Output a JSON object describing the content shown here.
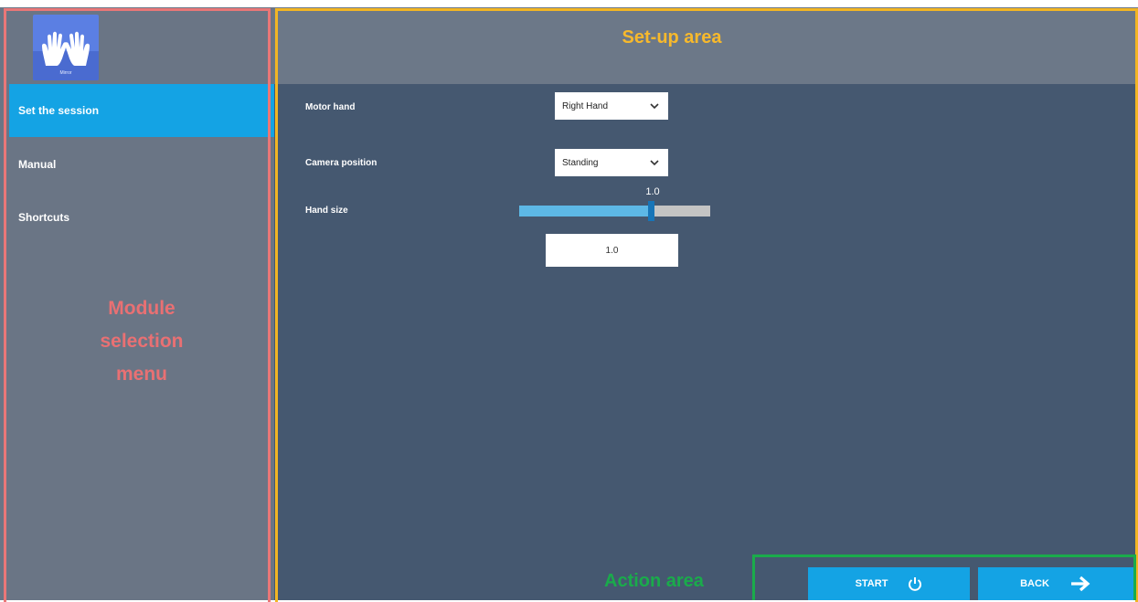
{
  "sidebar": {
    "logo_text": "Mirror",
    "items": [
      {
        "label": "Set the session",
        "active": true
      },
      {
        "label": "Manual",
        "active": false
      },
      {
        "label": "Shortcuts",
        "active": false
      }
    ],
    "annotation": "Module\nselection\nmenu"
  },
  "setup": {
    "title": "Set-up area",
    "motor_hand": {
      "label": "Motor hand",
      "value": "Right Hand"
    },
    "camera_position": {
      "label": "Camera position",
      "value": "Standing"
    },
    "hand_size": {
      "label": "Hand size",
      "slider_value": "1.0",
      "slider_fraction": 0.69,
      "input_value": "1.0"
    }
  },
  "actions": {
    "annotation": "Action area",
    "start_label": "START",
    "back_label": "BACK"
  },
  "colors": {
    "accent": "#14a3e4",
    "sidebar_bg": "#6a7585",
    "main_bg": "#455870",
    "module_frame": "#e97778",
    "setup_frame": "#f2b524",
    "action_frame": "#1aab4b"
  },
  "icons": [
    "hands-logo-icon",
    "chevron-down-icon",
    "power-icon",
    "arrow-right-icon"
  ]
}
